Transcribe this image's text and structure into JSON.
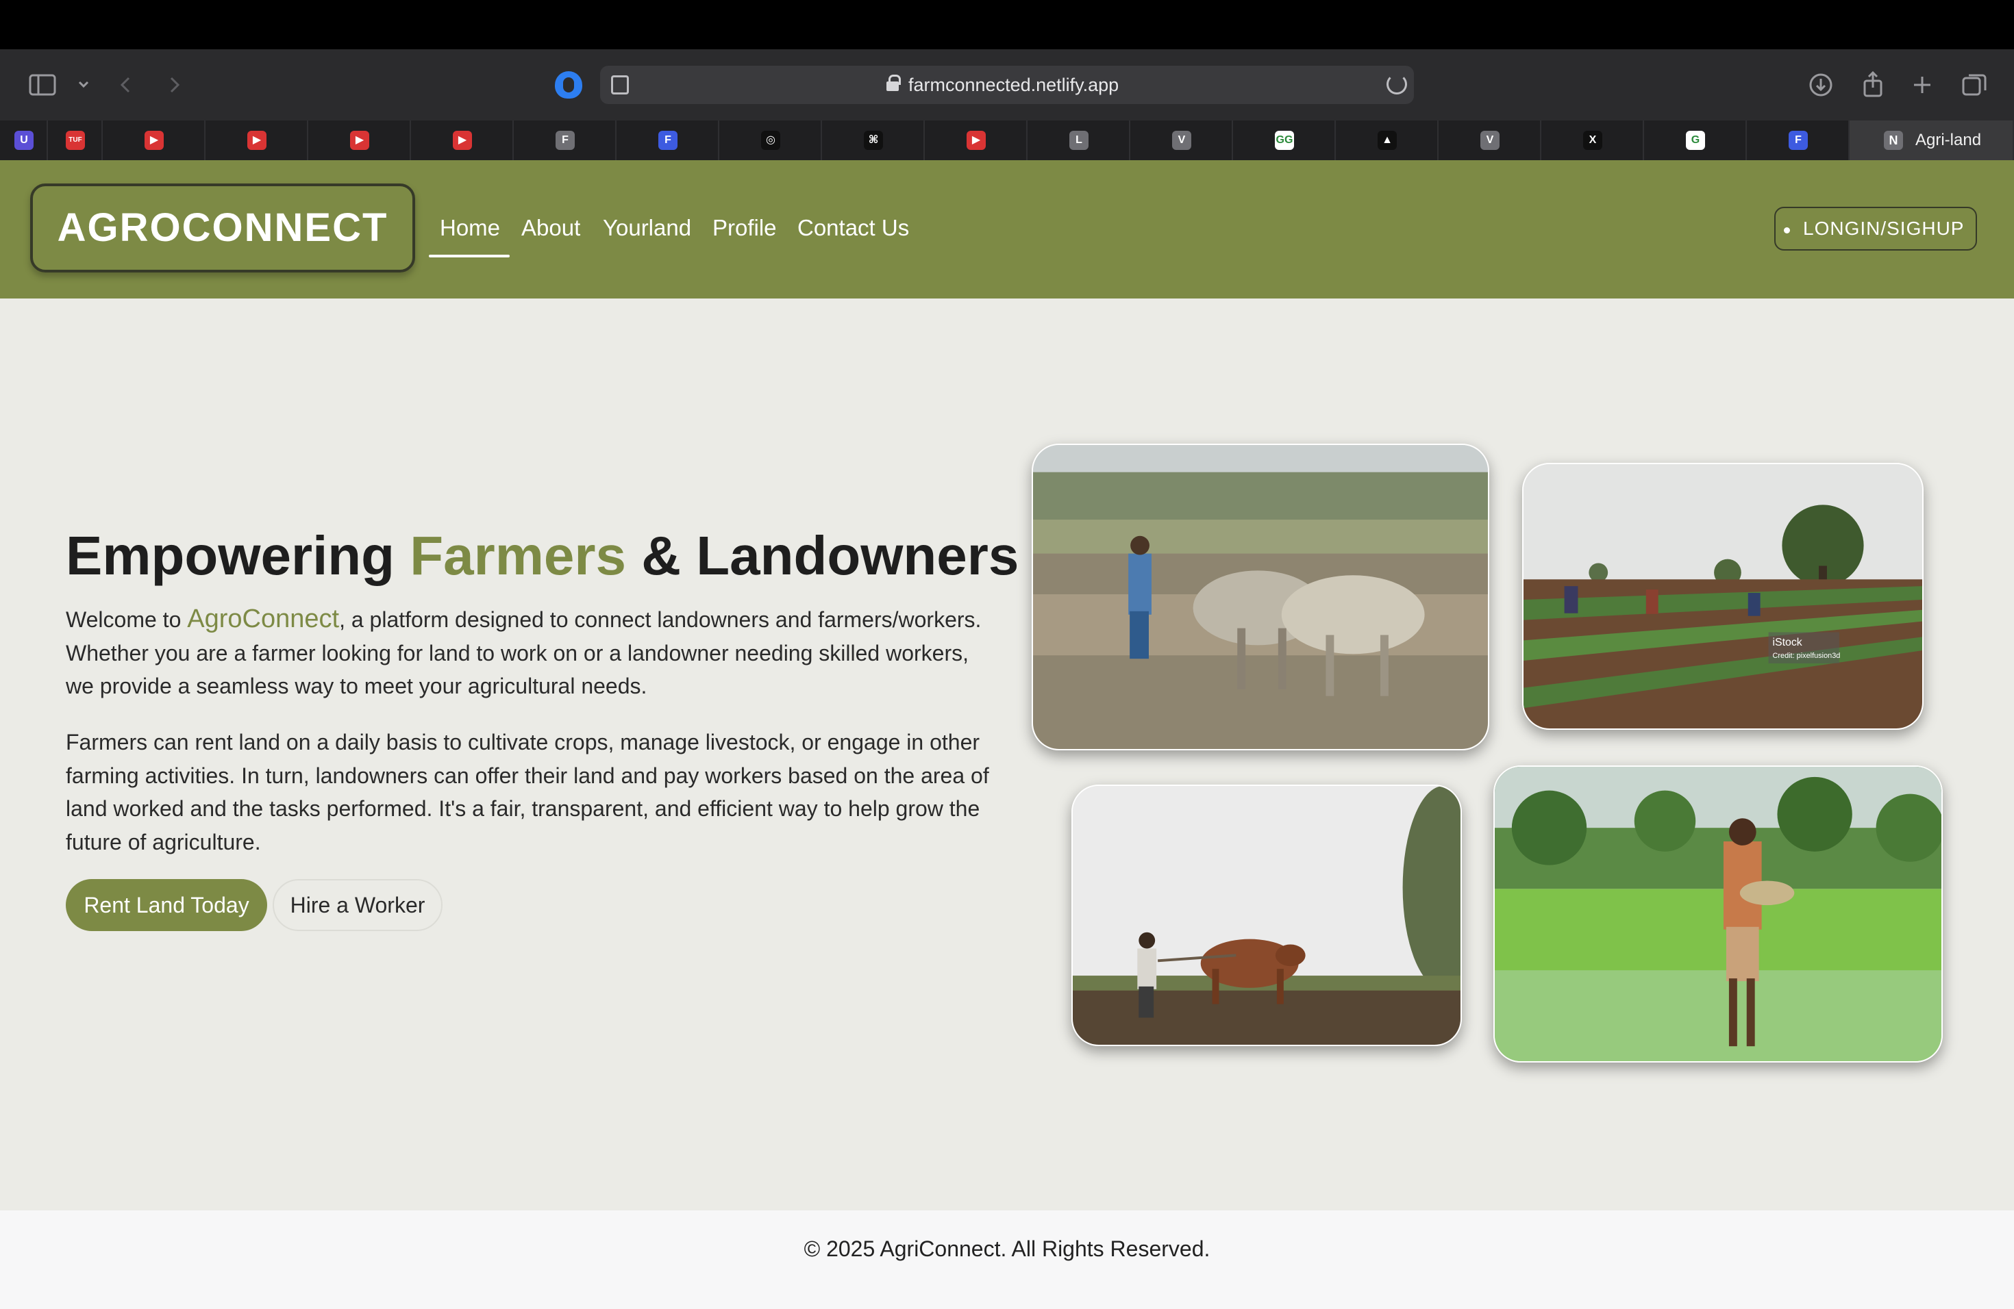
{
  "browser": {
    "url": "farmconnected.netlify.app",
    "active_tab_title": "Agri-land",
    "active_tab_favicon_letter": "N",
    "tab_favicons": [
      "U",
      "TUF",
      "▶",
      "▶",
      "▶",
      "▶",
      "F",
      "F",
      "◎",
      "⌘",
      "▶",
      "L",
      "V",
      "GG",
      "▲",
      "V",
      "X",
      "G",
      "F"
    ]
  },
  "nav": {
    "brand": "AGROCONNECT",
    "links": [
      "Home",
      "About",
      "Yourland",
      "Profile",
      "Contact Us"
    ],
    "active_link": "Home",
    "login_label": "LONGIN/SIGHUP"
  },
  "hero": {
    "headline_part1": "Empowering ",
    "headline_accent": "Farmers",
    "headline_part2": " & Landowners",
    "para1_prefix": "Welcome to ",
    "para1_brand": "AgroConnect",
    "para1_rest": ", a platform designed to connect landowners and farmers/workers. Whether you are a farmer looking for land to work on or a landowner needing skilled workers, we provide a seamless way to meet your agricultural needs.",
    "para2": "Farmers can rent land on a daily basis to cultivate crops, manage livestock, or engage in other farming activities. In turn, landowners can offer their land and pay workers based on the area of land worked and the tasks performed. It's a fair, transparent, and efficient way to help grow the future of agriculture.",
    "primary_button": "Rent Land Today",
    "secondary_button": "Hire a Worker"
  },
  "images": {
    "img2_watermark": "iStock",
    "img2_credit": "Credit: pixelfusion3d"
  },
  "footer": {
    "copyright": "© 2025 AgriConnect. All Rights Reserved."
  },
  "colors": {
    "brand_olive": "#7d8a45",
    "page_bg": "#ebebe6"
  }
}
